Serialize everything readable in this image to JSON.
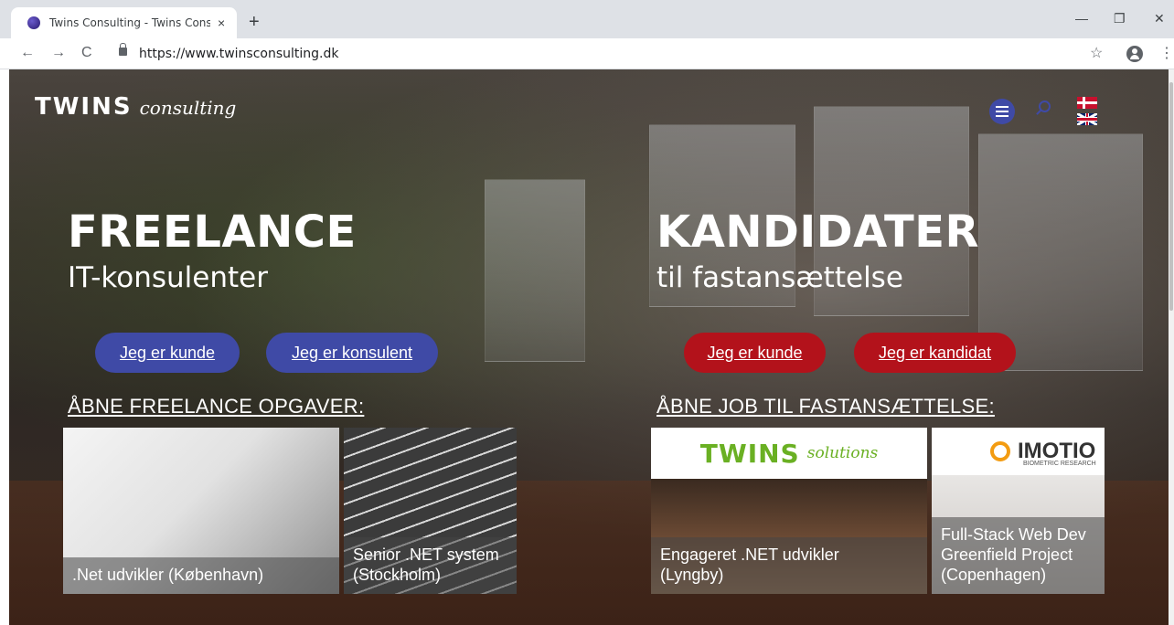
{
  "browser": {
    "tab_title": "Twins Consulting - Twins Consulti",
    "tab_close": "×",
    "new_tab": "+",
    "url": "https://www.twinsconsulting.dk",
    "back": "←",
    "forward": "→",
    "reload": "C",
    "bookmark": "☆",
    "menu": "⋮",
    "minimize": "—",
    "restore": "❐",
    "close": "✕"
  },
  "site": {
    "logo_main": "TWINS",
    "logo_sub": "consulting",
    "accent_blue": "#3f4aa6",
    "accent_red": "#b3121b"
  },
  "freelance": {
    "heading": "FREELANCE",
    "subheading": "IT-konsulenter",
    "btn_customer": "Jeg er kunde",
    "btn_consultant": "Jeg er konsulent",
    "section_title": "ÅBNE FREELANCE OPGAVER:",
    "cards": [
      {
        "label": ".Net udvikler (København)"
      },
      {
        "label_line1": "Senior .NET system",
        "label_line2": "(Stockholm)"
      }
    ]
  },
  "candidates": {
    "heading": "KANDIDATER",
    "subheading": "til fastansættelse",
    "btn_customer": "Jeg er kunde",
    "btn_candidate": "Jeg er kandidat",
    "section_title": "ÅBNE JOB TIL FASTANSÆTTELSE:",
    "cards": [
      {
        "logo_main": "TWINS",
        "logo_sub": "solutions",
        "label_line1": "Engageret .NET udvikler",
        "label_line2": "(Lyngby)"
      },
      {
        "logo_main": "IMOTIO",
        "logo_sub": "BIOMETRIC RESEARCH",
        "label_line1": "Full-Stack Web Dev",
        "label_line2": "Greenfield Project",
        "label_line3": "(Copenhagen)"
      }
    ]
  }
}
